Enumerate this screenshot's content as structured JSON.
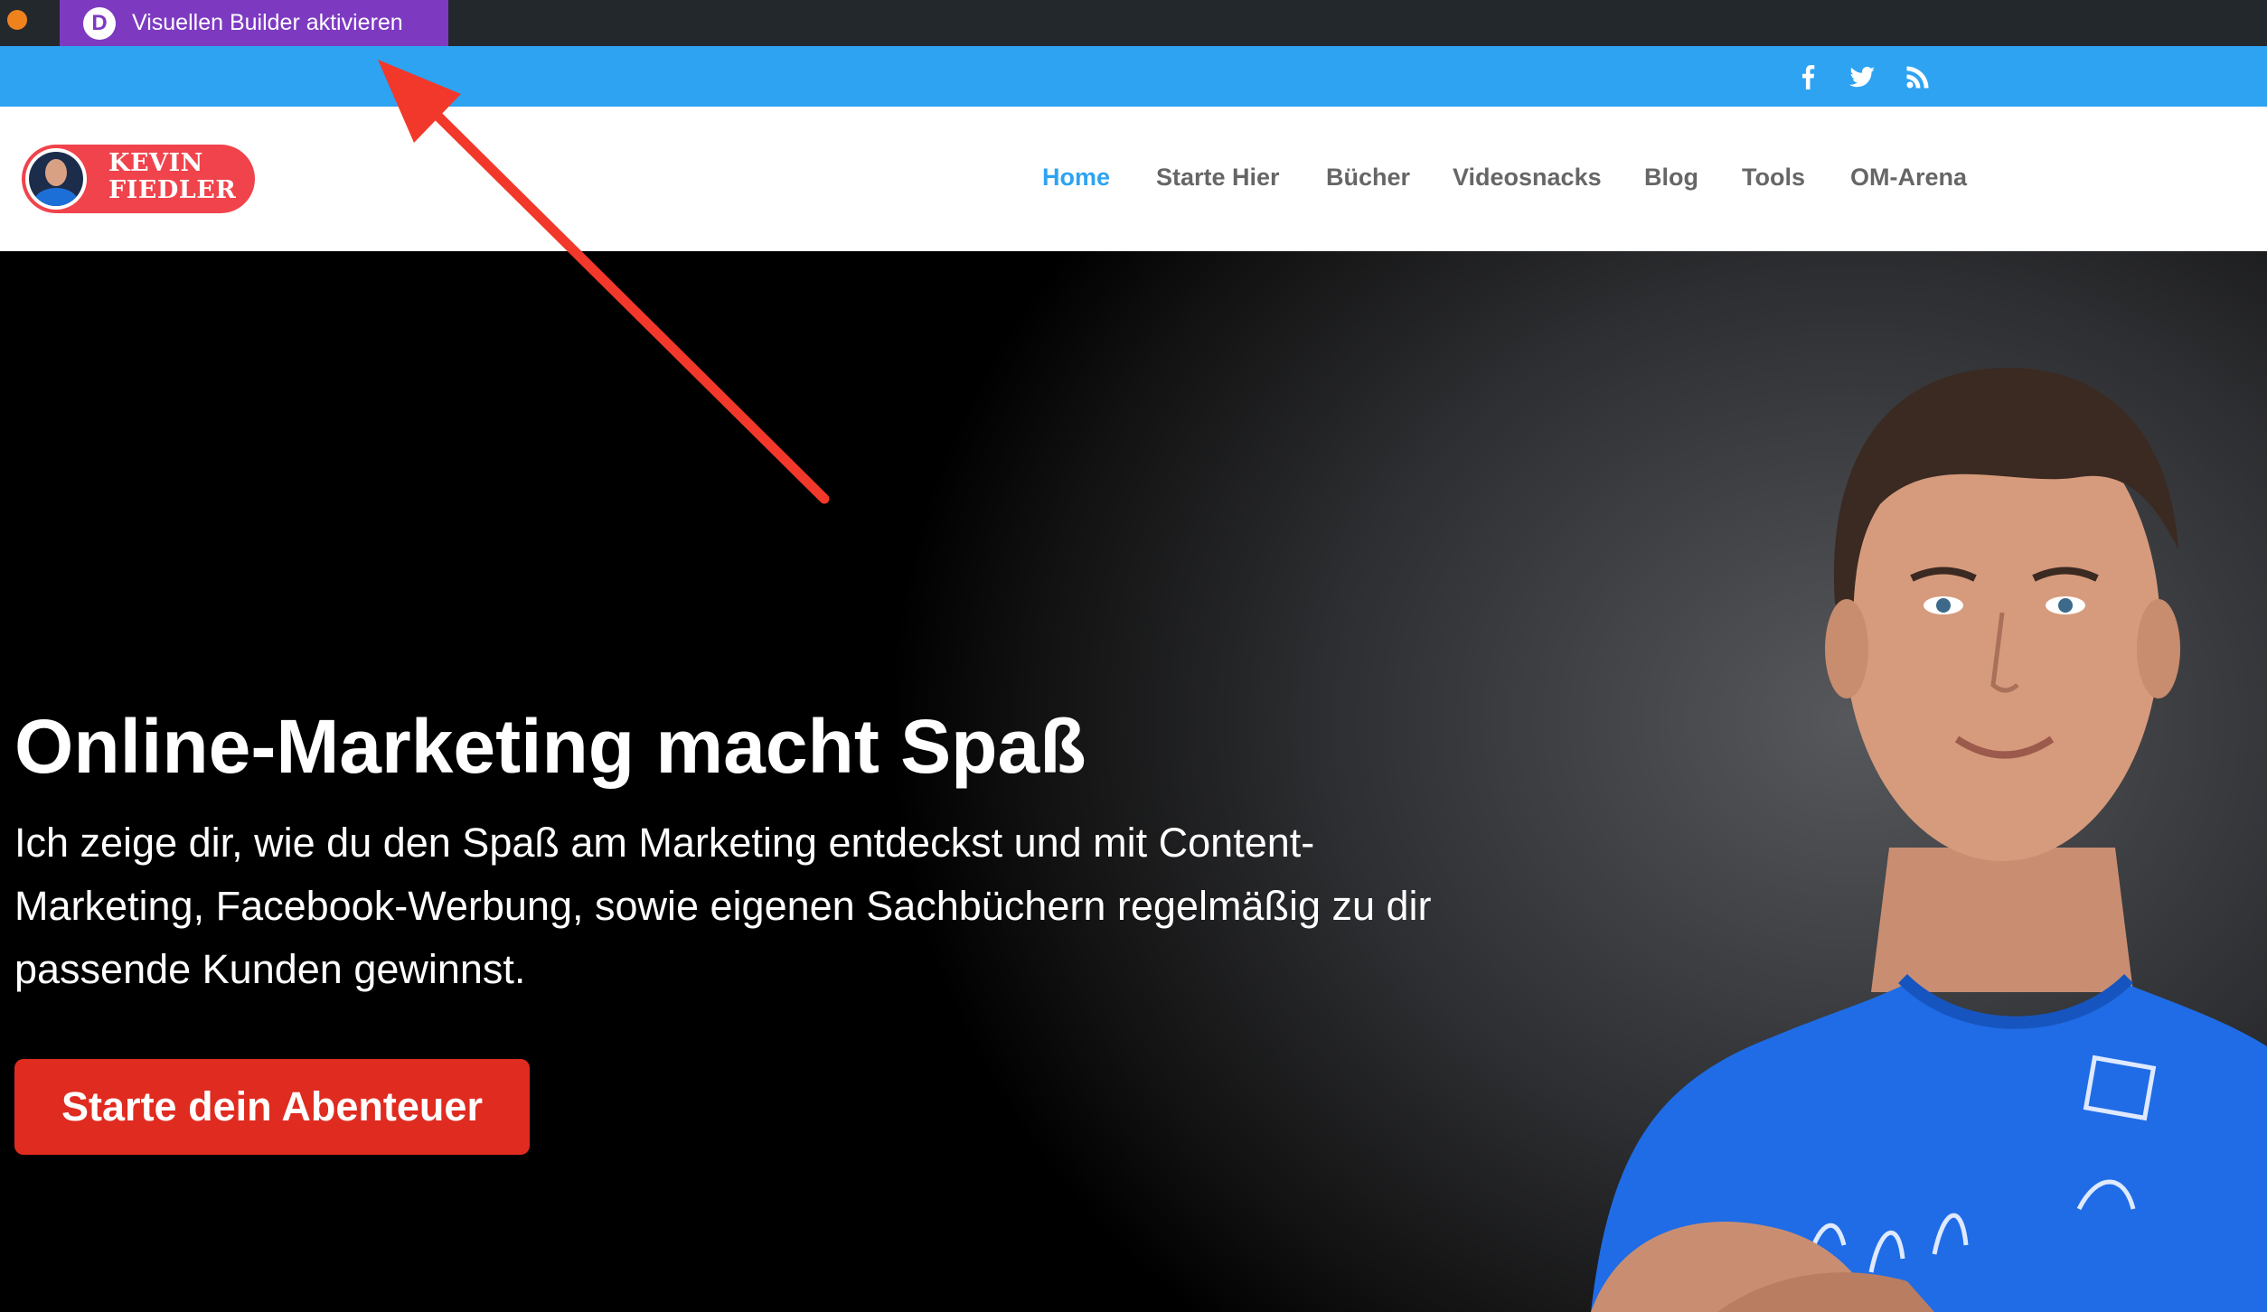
{
  "admin_bar": {
    "builder_button_label": "Visuellen Builder aktivieren",
    "builder_logo_letter": "D",
    "builder_color": "#7d3ac1"
  },
  "top_bar": {
    "color": "#2ea3f2",
    "social_icons": [
      "facebook-icon",
      "twitter-icon",
      "rss-icon"
    ]
  },
  "header": {
    "logo": {
      "line1": "KEVIN",
      "line2": "FIEDLER",
      "color": "#f0434c"
    },
    "nav": [
      {
        "label": "Home",
        "active": true
      },
      {
        "label": "Starte Hier",
        "active": false
      },
      {
        "label": "Bücher",
        "active": false
      },
      {
        "label": "Videosnacks",
        "active": false
      },
      {
        "label": "Blog",
        "active": false
      },
      {
        "label": "Tools",
        "active": false
      },
      {
        "label": "OM-Arena",
        "active": false
      }
    ],
    "nav_active_color": "#2ea3f2"
  },
  "hero": {
    "title": "Online-Marketing macht Spaß",
    "text": "Ich zeige dir, wie du den Spaß am Marketing entdeckst und mit Content-Marketing, Facebook-Werbung, sowie eigenen Sachbüchern regelmäßig zu dir passende Kunden gewinnst.",
    "cta_label": "Starte dein Abenteuer",
    "cta_color": "#e02b20"
  },
  "annotation": {
    "arrow_color": "#f2382a"
  }
}
